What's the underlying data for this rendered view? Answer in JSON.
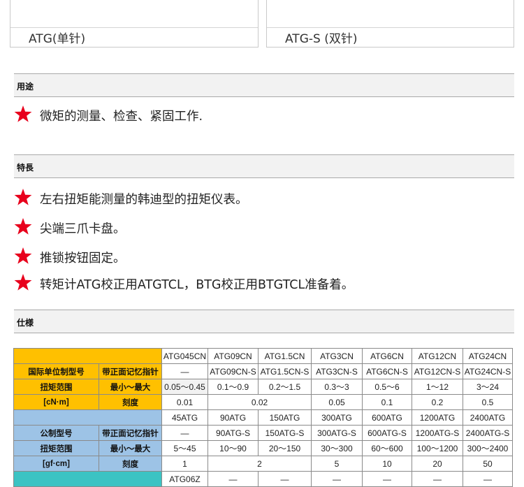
{
  "captions": {
    "left": "ATG(单针)",
    "right": "ATG-S (双针)"
  },
  "sections": {
    "usage": {
      "title": "用途",
      "items": [
        "微矩的测量、检查、紧固工作."
      ]
    },
    "features": {
      "title": "特長",
      "items": [
        "左右扭矩能测量的韩迪型的扭矩仪表。",
        "尖端三爪卡盘。",
        "推锁按钮固定。",
        "转矩计ATG校正用ATGTCL，BTG校正用BTGTCL准备着。"
      ]
    },
    "spec": {
      "title": "仕様"
    }
  },
  "colors": {
    "star": "#e8001c",
    "si_header": "#ffc000",
    "gf_header": "#9dc3e6",
    "next_header": "#3bc3c3"
  },
  "icons": {
    "bullet": "star-icon"
  },
  "table": {
    "si": {
      "models": [
        "ATG045CN",
        "ATG09CN",
        "ATG1.5CN",
        "ATG3CN",
        "ATG6CN",
        "ATG12CN",
        "ATG24CN"
      ],
      "label_model": "国际单位制型号",
      "label_memory": "带正面记忆指针",
      "memory": [
        "—",
        "ATG09CN-S",
        "ATG1.5CN-S",
        "ATG3CN-S",
        "ATG6CN-S",
        "ATG12CN-S",
        "ATG24CN-S"
      ],
      "label_range": "扭矩范围",
      "label_unit": "[cN·m]",
      "label_minmax": "最小～最大",
      "range": [
        "0.05～0.45",
        "0.1～0.9",
        "0.2～1.5",
        "0.3～3",
        "0.5～6",
        "1～12",
        "3～24"
      ],
      "label_grad": "刻度",
      "grad": [
        "0.01",
        "0.02",
        "0.05",
        "0.1",
        "0.2",
        "0.5"
      ]
    },
    "gf": {
      "models": [
        "45ATG",
        "90ATG",
        "150ATG",
        "300ATG",
        "600ATG",
        "1200ATG",
        "2400ATG"
      ],
      "label_model": "公制型号",
      "label_memory": "带正面记忆指针",
      "memory": [
        "—",
        "90ATG-S",
        "150ATG-S",
        "300ATG-S",
        "600ATG-S",
        "1200ATG-S",
        "2400ATG-S"
      ],
      "label_range": "扭矩范围",
      "label_unit": "[gf·cm]",
      "label_minmax": "最小～最大",
      "range": [
        "5～45",
        "10～90",
        "20～150",
        "30～300",
        "60～600",
        "100～1200",
        "300～2400"
      ],
      "label_grad": "刻度",
      "grad": [
        "1",
        "2",
        "5",
        "10",
        "20",
        "50"
      ]
    },
    "next": {
      "models": [
        "ATG06Z",
        "—",
        "—",
        "—",
        "—",
        "—",
        "—"
      ]
    }
  }
}
